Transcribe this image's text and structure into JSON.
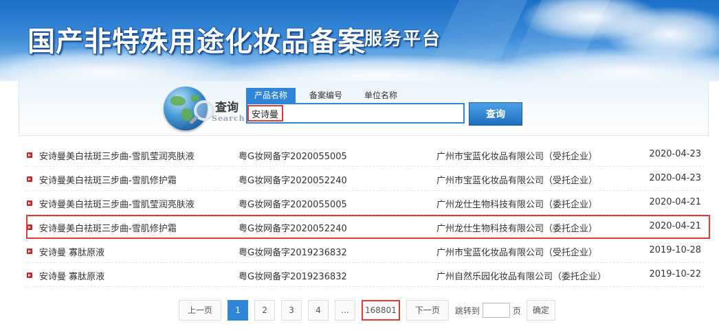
{
  "header": {
    "title": "国产非特殊用途化妆品备案",
    "subtitle": "服务平台"
  },
  "search": {
    "label_cn": "查询",
    "label_en": "Search",
    "tabs": [
      {
        "label": "产品名称",
        "active": true
      },
      {
        "label": "备案编号",
        "active": false
      },
      {
        "label": "单位名称",
        "active": false
      }
    ],
    "query": "安诗曼",
    "button_label": "查询"
  },
  "results": [
    {
      "name": "安诗曼美白祛斑三步曲-雪肌莹润亮肤液",
      "record_no": "粤G妆网备字2020055005",
      "company": "广州市宝蓝化妆品有限公司（受托企业）",
      "date": "2020-04-23"
    },
    {
      "name": "安诗曼美白祛斑三步曲-雪肌修护霜",
      "record_no": "粤G妆网备字2020052240",
      "company": "广州市宝蓝化妆品有限公司（受托企业）",
      "date": "2020-04-23"
    },
    {
      "name": "安诗曼美白祛斑三步曲-雪肌莹润亮肤液",
      "record_no": "粤G妆网备字2020055005",
      "company": "广州龙仕生物科技有限公司（委托企业）",
      "date": "2020-04-21"
    },
    {
      "name": "安诗曼美白祛斑三步曲-雪肌修护霜",
      "record_no": "粤G妆网备字2020052240",
      "company": "广州龙仕生物科技有限公司（委托企业）",
      "date": "2020-04-21"
    },
    {
      "name": "安诗曼 寡肽原液",
      "record_no": "粤G妆网备字2019236832",
      "company": "广州市宝蓝化妆品有限公司（受托企业）",
      "date": "2019-10-28"
    },
    {
      "name": "安诗曼 寡肽原液",
      "record_no": "粤G妆网备字2019236832",
      "company": "广州自然乐园化妆品有限公司（委托企业）",
      "date": "2019-10-22"
    }
  ],
  "pagination": {
    "prev": "上一页",
    "pages": [
      "1",
      "2",
      "3",
      "4"
    ],
    "current": "1",
    "ellipsis": "...",
    "last": "168801",
    "next": "下一页",
    "jump_label": "跳转到",
    "jump_suffix": "页",
    "confirm": "确定"
  },
  "colors": {
    "accent": "#2f86d6",
    "highlight": "#e53935",
    "bullet": "#c62828"
  }
}
